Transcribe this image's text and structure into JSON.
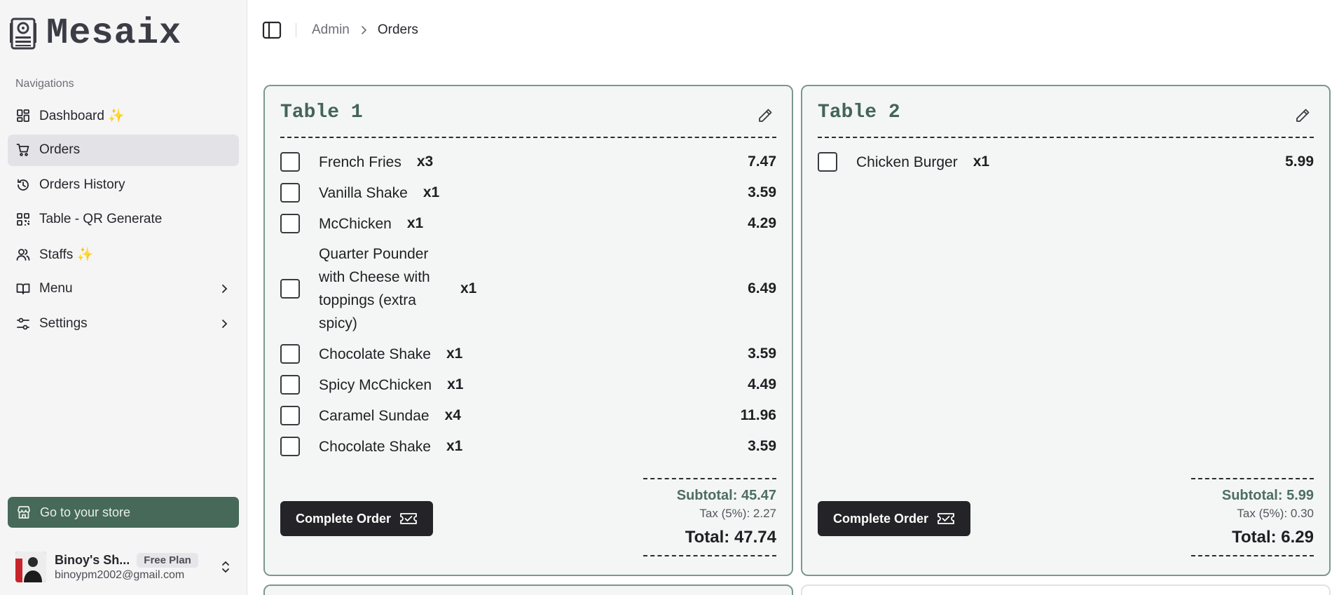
{
  "app": {
    "name": "Mesaix"
  },
  "sidebar": {
    "group_label": "Navigations",
    "items": [
      {
        "label": "Dashboard ✨",
        "icon": "dashboard-icon"
      },
      {
        "label": "Orders",
        "icon": "cart-icon",
        "active": true
      },
      {
        "label": "Orders History",
        "icon": "history-icon"
      },
      {
        "label": "Table - QR Generate",
        "icon": "qr-code-icon"
      },
      {
        "label": "Staffs ✨",
        "icon": "users-icon"
      },
      {
        "label": "Menu",
        "icon": "book-icon"
      },
      {
        "label": "Settings",
        "icon": "settings-sliders-icon"
      }
    ],
    "store_button": "Go to your store",
    "user": {
      "name": "Binoy's Sh...",
      "plan": "Free Plan",
      "email": "binoypm2002@gmail.com"
    }
  },
  "header": {
    "breadcrumb_parent": "Admin",
    "breadcrumb_current": "Orders"
  },
  "colors": {
    "accent": "#46695a",
    "card_border": "#7c978c",
    "card_bg": "#f4f6f5",
    "title": "#43645a"
  },
  "orders": [
    {
      "table": "Table 1",
      "items": [
        {
          "name": "French Fries",
          "qty": "x3",
          "price": "7.47"
        },
        {
          "name": "Vanilla Shake",
          "qty": "x1",
          "price": "3.59"
        },
        {
          "name": "McChicken",
          "qty": "x1",
          "price": "4.29"
        },
        {
          "name": "Quarter Pounder with Cheese with toppings (extra spicy)",
          "qty": "x1",
          "price": "6.49"
        },
        {
          "name": "Chocolate Shake",
          "qty": "x1",
          "price": "3.59"
        },
        {
          "name": "Spicy McChicken",
          "qty": "x1",
          "price": "4.49"
        },
        {
          "name": "Caramel Sundae",
          "qty": "x4",
          "price": "11.96"
        },
        {
          "name": "Chocolate Shake",
          "qty": "x1",
          "price": "3.59"
        }
      ],
      "subtotal": "Subtotal: 45.47",
      "tax": "Tax (5%): 2.27",
      "total": "Total: 47.74",
      "button": "Complete Order"
    },
    {
      "table": "Table 2",
      "items": [
        {
          "name": "Chicken Burger",
          "qty": "x1",
          "price": "5.99"
        }
      ],
      "subtotal": "Subtotal: 5.99",
      "tax": "Tax (5%): 0.30",
      "total": "Total: 6.29",
      "button": "Complete Order"
    }
  ]
}
